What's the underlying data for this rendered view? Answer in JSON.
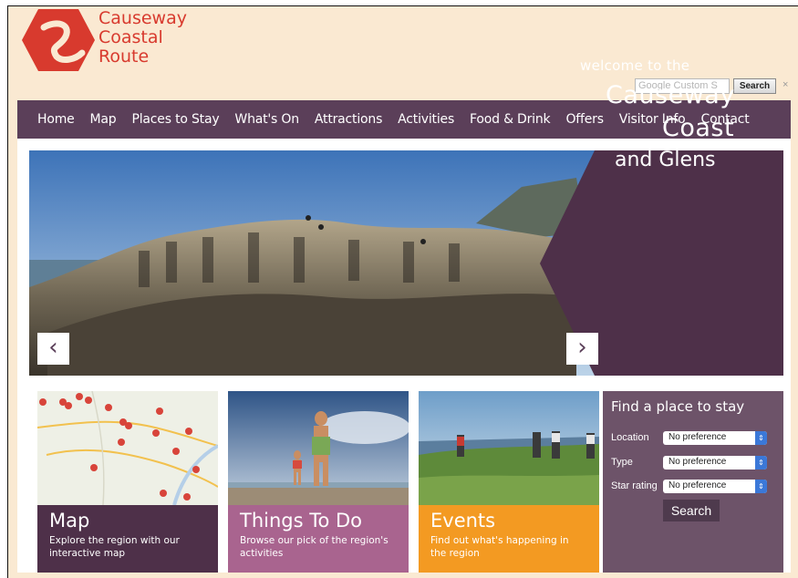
{
  "brand": {
    "line1": "Causeway",
    "line2": "Coastal",
    "line3": "Route",
    "color": "#d83a2e"
  },
  "search": {
    "placeholder": "Google  Custom S",
    "button_label": "Search",
    "close_glyph": "×"
  },
  "nav": {
    "items": [
      {
        "label": "Home"
      },
      {
        "label": "Map"
      },
      {
        "label": "Places to Stay"
      },
      {
        "label": "What's On"
      },
      {
        "label": "Attractions"
      },
      {
        "label": "Activities"
      },
      {
        "label": "Food & Drink"
      },
      {
        "label": "Offers"
      },
      {
        "label": "Visitor Info"
      },
      {
        "label": "Contact"
      }
    ],
    "background": "#5b3f59"
  },
  "hero": {
    "welcome": "welcome to the",
    "title_line1": "Causeway",
    "title_line2": "Coast",
    "title_line3": "and Glens",
    "prev_glyph": "‹",
    "next_glyph": "›",
    "panel_color": "#4e3049"
  },
  "tiles": [
    {
      "title": "Map",
      "desc": "Explore the region with our interactive map",
      "color": "#4e3049"
    },
    {
      "title": "Things To Do",
      "desc": "Browse our pick of the region's activities",
      "color": "#a9648f"
    },
    {
      "title": "Events",
      "desc": "Find out what's happening in the region",
      "color": "#f39a22"
    }
  ],
  "find": {
    "title": "Find a place to stay",
    "fields": [
      {
        "label": "Location",
        "value": "No preference"
      },
      {
        "label": "Type",
        "value": "No preference"
      },
      {
        "label": "Star rating",
        "value": "No preference"
      }
    ],
    "button_label": "Search"
  }
}
